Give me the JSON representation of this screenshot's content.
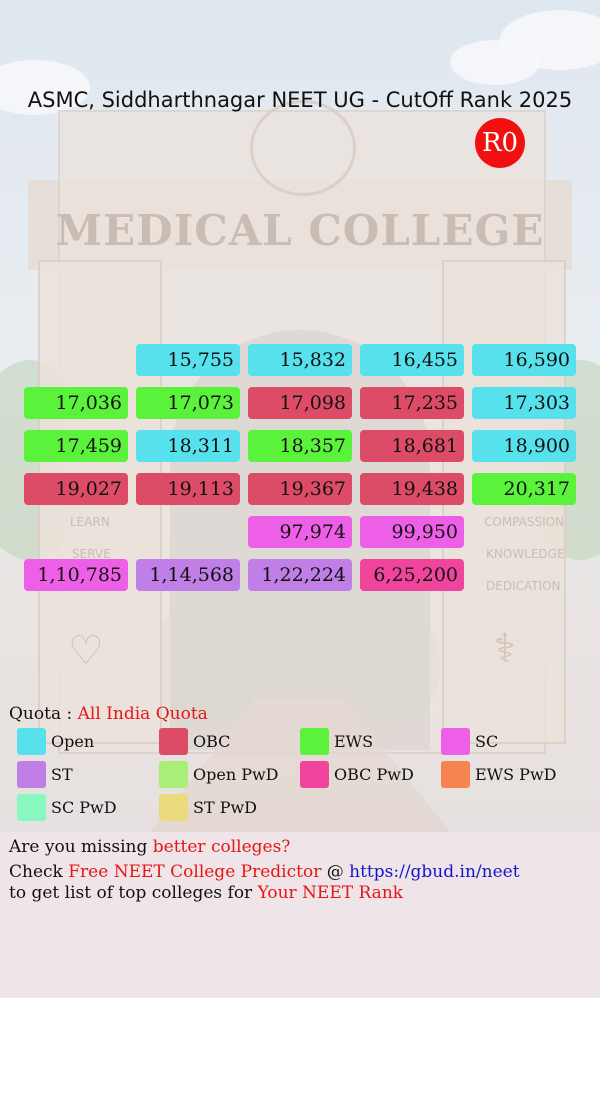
{
  "title": "ASMC, Siddharthnagar NEET UG - CutOff Rank 2025",
  "round_badge": "R0",
  "background_sign": "MEDICAL COLLEGE",
  "background_pillar_words_left": [
    "LEARN",
    "SERVE"
  ],
  "background_pillar_words_right": [
    "COMPASSION",
    "KNOWLEDGE",
    "DEDICATION"
  ],
  "colors": {
    "Open": "#56e1ec",
    "OBC": "#dd4c67",
    "EWS": "#5bf23b",
    "SC": "#ee5fe8",
    "ST": "#c07fe6",
    "Open PwD": "#aaee77",
    "OBC PwD": "#f0449d",
    "EWS PwD": "#f58450",
    "SC PwD": "#88f7c0",
    "ST PwD": "#ecdb7c"
  },
  "cutoff_rows": [
    [
      null,
      {
        "rank": "15,755",
        "category": "Open"
      },
      {
        "rank": "15,832",
        "category": "Open"
      },
      {
        "rank": "16,455",
        "category": "Open"
      },
      {
        "rank": "16,590",
        "category": "Open"
      }
    ],
    [
      {
        "rank": "17,036",
        "category": "EWS"
      },
      {
        "rank": "17,073",
        "category": "EWS"
      },
      {
        "rank": "17,098",
        "category": "OBC"
      },
      {
        "rank": "17,235",
        "category": "OBC"
      },
      {
        "rank": "17,303",
        "category": "Open"
      }
    ],
    [
      {
        "rank": "17,459",
        "category": "EWS"
      },
      {
        "rank": "18,311",
        "category": "Open"
      },
      {
        "rank": "18,357",
        "category": "EWS"
      },
      {
        "rank": "18,681",
        "category": "OBC"
      },
      {
        "rank": "18,900",
        "category": "Open"
      }
    ],
    [
      {
        "rank": "19,027",
        "category": "OBC"
      },
      {
        "rank": "19,113",
        "category": "OBC"
      },
      {
        "rank": "19,367",
        "category": "OBC"
      },
      {
        "rank": "19,438",
        "category": "OBC"
      },
      {
        "rank": "20,317",
        "category": "EWS"
      }
    ],
    [
      null,
      null,
      {
        "rank": "97,974",
        "category": "SC"
      },
      {
        "rank": "99,950",
        "category": "SC"
      },
      null
    ],
    [
      {
        "rank": "1,10,785",
        "category": "SC"
      },
      {
        "rank": "1,14,568",
        "category": "ST"
      },
      {
        "rank": "1,22,224",
        "category": "ST"
      },
      {
        "rank": "6,25,200",
        "category": "OBC PwD"
      },
      null
    ]
  ],
  "quota": {
    "label": "Quota : ",
    "value": "All India Quota"
  },
  "legend": [
    "Open",
    "OBC",
    "EWS",
    "SC",
    "ST",
    "Open PwD",
    "OBC PwD",
    "EWS PwD",
    "SC PwD",
    "ST PwD"
  ],
  "promo": {
    "line1_a": "Are you missing ",
    "line1_b": "better colleges?",
    "line2_a": "Check ",
    "line2_b": "Free NEET College Predictor",
    "line2_c": " @ ",
    "line2_d": "https://gbud.in/neet",
    "line3_a": "to get list of top colleges for ",
    "line3_b": "Your NEET Rank"
  }
}
